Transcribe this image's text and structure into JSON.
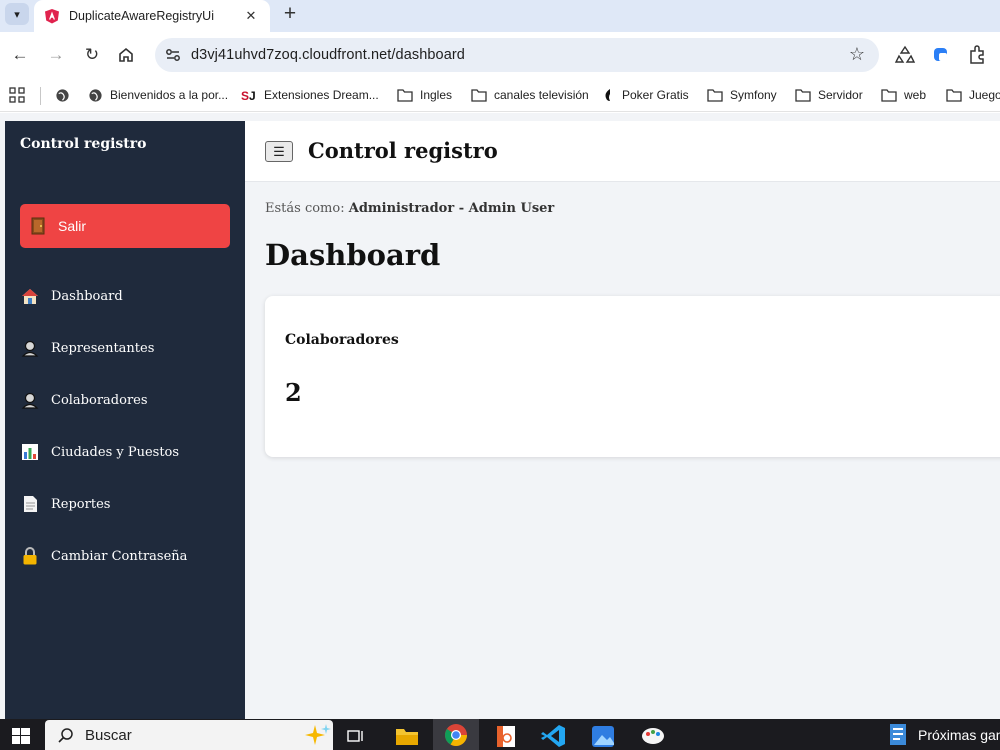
{
  "browser": {
    "tab_title": "DuplicateAwareRegistryUi",
    "url": "d3vj41uhvd7zoq.cloudfront.net/dashboard",
    "bookmarks": [
      {
        "label": "",
        "icon": "apps-grid-icon"
      },
      {
        "label": "",
        "icon": "globe-icon"
      },
      {
        "label": "Bienvenidos a la por...",
        "icon": "globe-icon"
      },
      {
        "label": "Extensiones Dream...",
        "icon": "sj-favicon-icon"
      },
      {
        "label": "Ingles",
        "icon": "folder-icon"
      },
      {
        "label": "canales televisión",
        "icon": "folder-icon"
      },
      {
        "label": "Poker Gratis",
        "icon": "poker-favicon-icon"
      },
      {
        "label": "Symfony",
        "icon": "folder-icon"
      },
      {
        "label": "Servidor",
        "icon": "folder-icon"
      },
      {
        "label": "web",
        "icon": "folder-icon"
      },
      {
        "label": "Juego",
        "icon": "folder-icon"
      }
    ]
  },
  "sidebar": {
    "brand": "Control registro",
    "logout_label": "Salir",
    "items": [
      {
        "label": "Dashboard",
        "icon": "house-icon"
      },
      {
        "label": "Representantes",
        "icon": "person-icon"
      },
      {
        "label": "Colaboradores",
        "icon": "person-icon"
      },
      {
        "label": "Ciudades y Puestos",
        "icon": "bar-chart-icon"
      },
      {
        "label": "Reportes",
        "icon": "document-icon"
      },
      {
        "label": "Cambiar Contraseña",
        "icon": "lock-icon"
      }
    ]
  },
  "header": {
    "menu_glyph": "☰",
    "brand": "Control registro"
  },
  "main": {
    "user_prefix": "Estás como:",
    "user_role": "Administrador - Admin User",
    "title": "Dashboard",
    "card": {
      "title": "Colaboradores",
      "value": "2"
    }
  },
  "taskbar": {
    "search_placeholder": "Buscar",
    "news_label": "Próximas gan"
  },
  "colors": {
    "sidebar_bg": "#1f2a3c",
    "logout_bg": "#ef4444",
    "tabstrip_bg": "#dfe8f7",
    "omnibox_bg": "#e9eef6"
  }
}
